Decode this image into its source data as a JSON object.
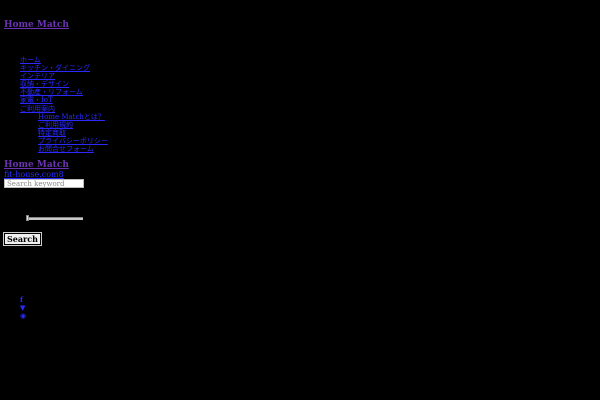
{
  "header": {
    "brand": "Home Match"
  },
  "nav": {
    "items": [
      "ホーム",
      "キッチン・ダイニング",
      "インテリア",
      "収納・デザイン",
      "不動産・リフォーム",
      "家電・IoT",
      "ご利用案内"
    ],
    "sub_items": [
      "Home Matchとは？",
      "ご利用規約",
      "特定商取",
      "プライバシーポリシー",
      "お問合せフォーム"
    ]
  },
  "search": {
    "brand": "Home Match",
    "domain": "fit-house.com8",
    "placeholder": "Search keyword",
    "slider_level": 0,
    "button_label": "Search"
  },
  "social": {
    "items": [
      {
        "icon": "facebook-icon",
        "glyph": "f"
      },
      {
        "icon": "twitter-icon",
        "glyph": "▼"
      },
      {
        "icon": "instagram-icon",
        "glyph": "◉"
      }
    ]
  }
}
